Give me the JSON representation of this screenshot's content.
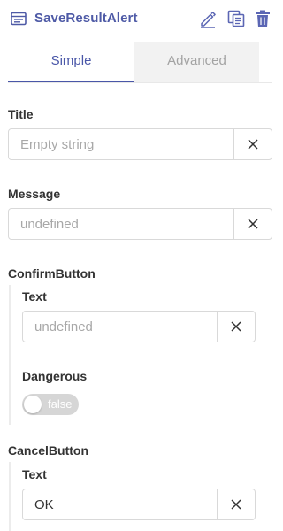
{
  "header": {
    "title": "SaveResultAlert",
    "icons": {
      "component": "component-icon",
      "edit": "edit-icon",
      "copy": "copy-icon",
      "delete": "trash-icon"
    },
    "accent_color": "#4e5aa6"
  },
  "tabs": [
    {
      "label": "Simple",
      "active": true
    },
    {
      "label": "Advanced",
      "active": false
    }
  ],
  "fields": {
    "title": {
      "label": "Title",
      "value": "",
      "placeholder": "Empty string"
    },
    "message": {
      "label": "Message",
      "value": "",
      "placeholder": "undefined"
    }
  },
  "confirm_button": {
    "label": "ConfirmButton",
    "text": {
      "label": "Text",
      "value": "",
      "placeholder": "undefined"
    },
    "dangerous": {
      "label": "Dangerous",
      "value_label": "false"
    }
  },
  "cancel_button": {
    "label": "CancelButton",
    "text": {
      "label": "Text",
      "value": "OK",
      "placeholder": ""
    }
  },
  "clear_icon": "close-icon"
}
